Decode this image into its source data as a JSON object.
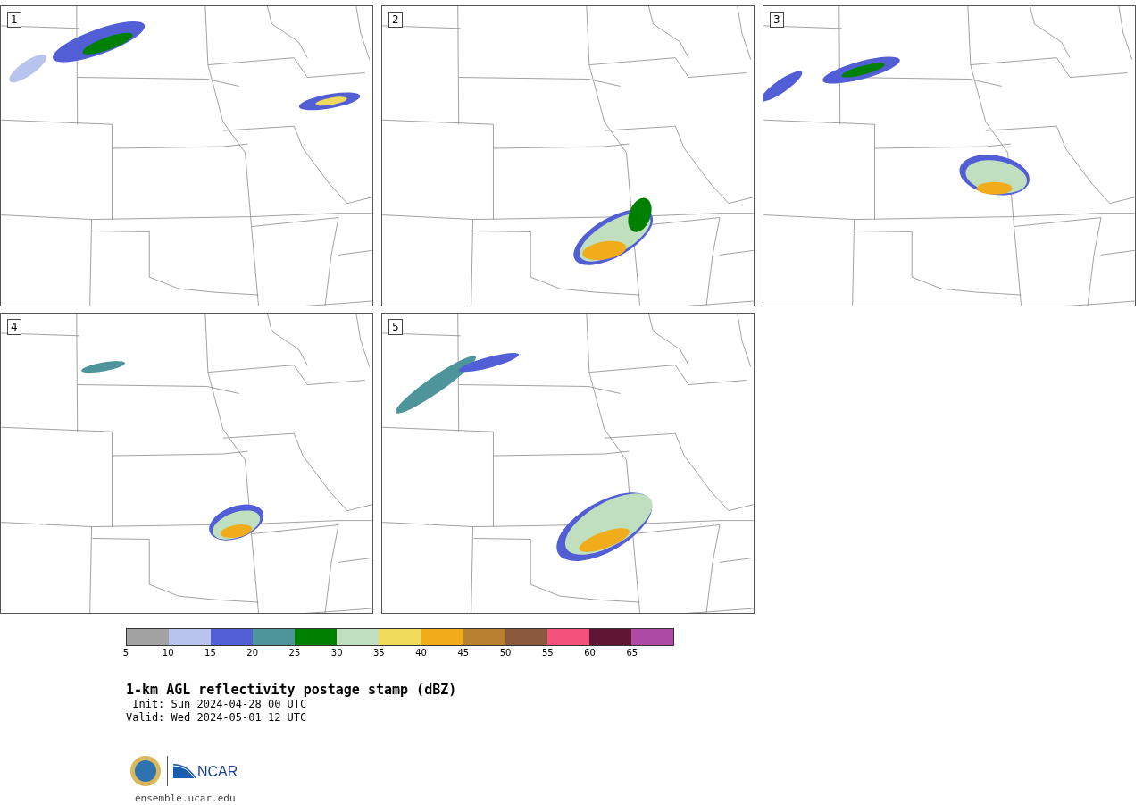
{
  "panels": [
    {
      "label": "1"
    },
    {
      "label": "2"
    },
    {
      "label": "3"
    },
    {
      "label": "4"
    },
    {
      "label": "5"
    }
  ],
  "colorbar": {
    "bins": [
      {
        "color": "#a3a3a3"
      },
      {
        "color": "#b8c4ee"
      },
      {
        "color": "#525ed6"
      },
      {
        "color": "#4e959b"
      },
      {
        "color": "#008000"
      },
      {
        "color": "#bfdfbf"
      },
      {
        "color": "#f0da5c"
      },
      {
        "color": "#f0ac1a"
      },
      {
        "color": "#b8812f"
      },
      {
        "color": "#8b5a3c"
      },
      {
        "color": "#f5517d"
      },
      {
        "color": "#5f1534"
      },
      {
        "color": "#ad4aa5"
      }
    ],
    "ticks": [
      "5",
      "10",
      "15",
      "20",
      "25",
      "30",
      "35",
      "40",
      "45",
      "50",
      "55",
      "60",
      "65"
    ]
  },
  "title": "1-km AGL reflectivity postage stamp (dBZ)",
  "init": " Init: Sun 2024-04-28 00 UTC",
  "valid": "Valid: Wed 2024-05-01 12 UTC",
  "logo_text": "NCAR",
  "url": "ensemble.ucar.edu"
}
